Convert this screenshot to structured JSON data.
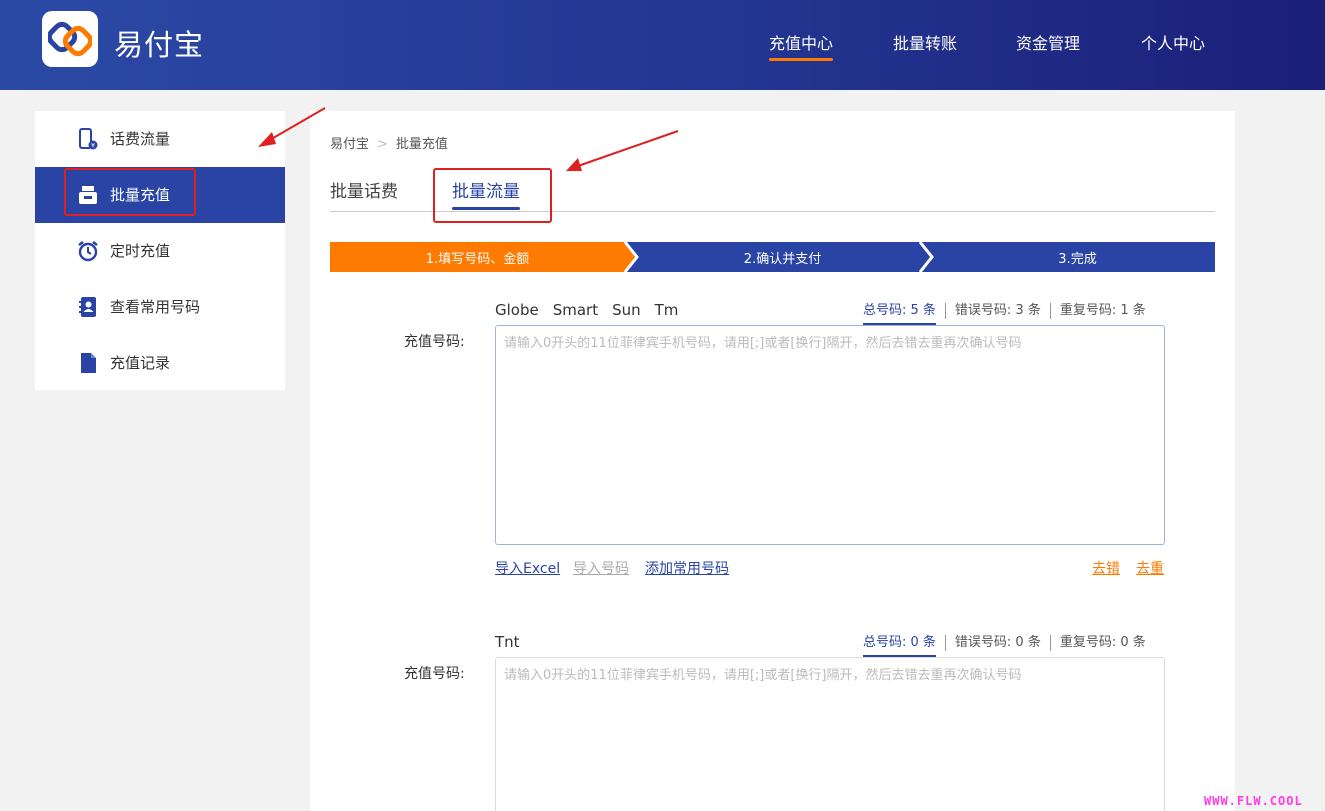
{
  "app": {
    "brand": "易付宝",
    "brand_color": "#2a44a5",
    "accent_color": "#ff7a00"
  },
  "nav": [
    {
      "label": "充值中心",
      "active": true
    },
    {
      "label": "批量转账",
      "active": false
    },
    {
      "label": "资金管理",
      "active": false
    },
    {
      "label": "个人中心",
      "active": false
    }
  ],
  "sidebar": {
    "items": [
      {
        "label": "话费流量",
        "icon": "phone-recharge-icon",
        "active": false
      },
      {
        "label": "批量充值",
        "icon": "batch-recharge-icon",
        "active": true
      },
      {
        "label": "定时充值",
        "icon": "alarm-clock-icon",
        "active": false
      },
      {
        "label": "查看常用号码",
        "icon": "contact-book-icon",
        "active": false
      },
      {
        "label": "充值记录",
        "icon": "document-icon",
        "active": false
      }
    ]
  },
  "breadcrumb": {
    "home": "易付宝",
    "separator": ">",
    "current": "批量充值"
  },
  "tabs": [
    {
      "label": "批量话费",
      "active": false
    },
    {
      "label": "批量流量",
      "active": true
    }
  ],
  "steps": [
    {
      "label": "1.填写号码、金额",
      "state": "current",
      "color": "#ff7a00"
    },
    {
      "label": "2.确认并支付",
      "state": "pending",
      "color": "#2a44a5"
    },
    {
      "label": "3.完成",
      "state": "pending",
      "color": "#2a44a5"
    }
  ],
  "block1": {
    "carriers": [
      "Globe",
      "Smart",
      "Sun",
      "Tm"
    ],
    "total": "总号码: 5 条",
    "errors": "错误号码: 3 条",
    "duplicates": "重复号码: 1 条",
    "label": "充值号码:",
    "placeholder": "请输入0开头的11位菲律宾手机号码，请用[;]或者[换行]隔开，然后去错去重再次确认号码",
    "import_excel": "导入Excel",
    "import_numbers": "导入号码",
    "add_common": "添加常用号码",
    "remove_errors": "去错",
    "remove_dup": "去重"
  },
  "block2": {
    "carriers": [
      "Tnt"
    ],
    "total": "总号码: 0 条",
    "errors": "错误号码: 0 条",
    "duplicates": "重复号码: 0 条",
    "label": "充值号码:",
    "placeholder": "请输入0开头的11位菲律宾手机号码，请用[;]或者[换行]隔开，然后去错去重再次确认号码"
  },
  "watermark": "WWW.FLW.COOL"
}
